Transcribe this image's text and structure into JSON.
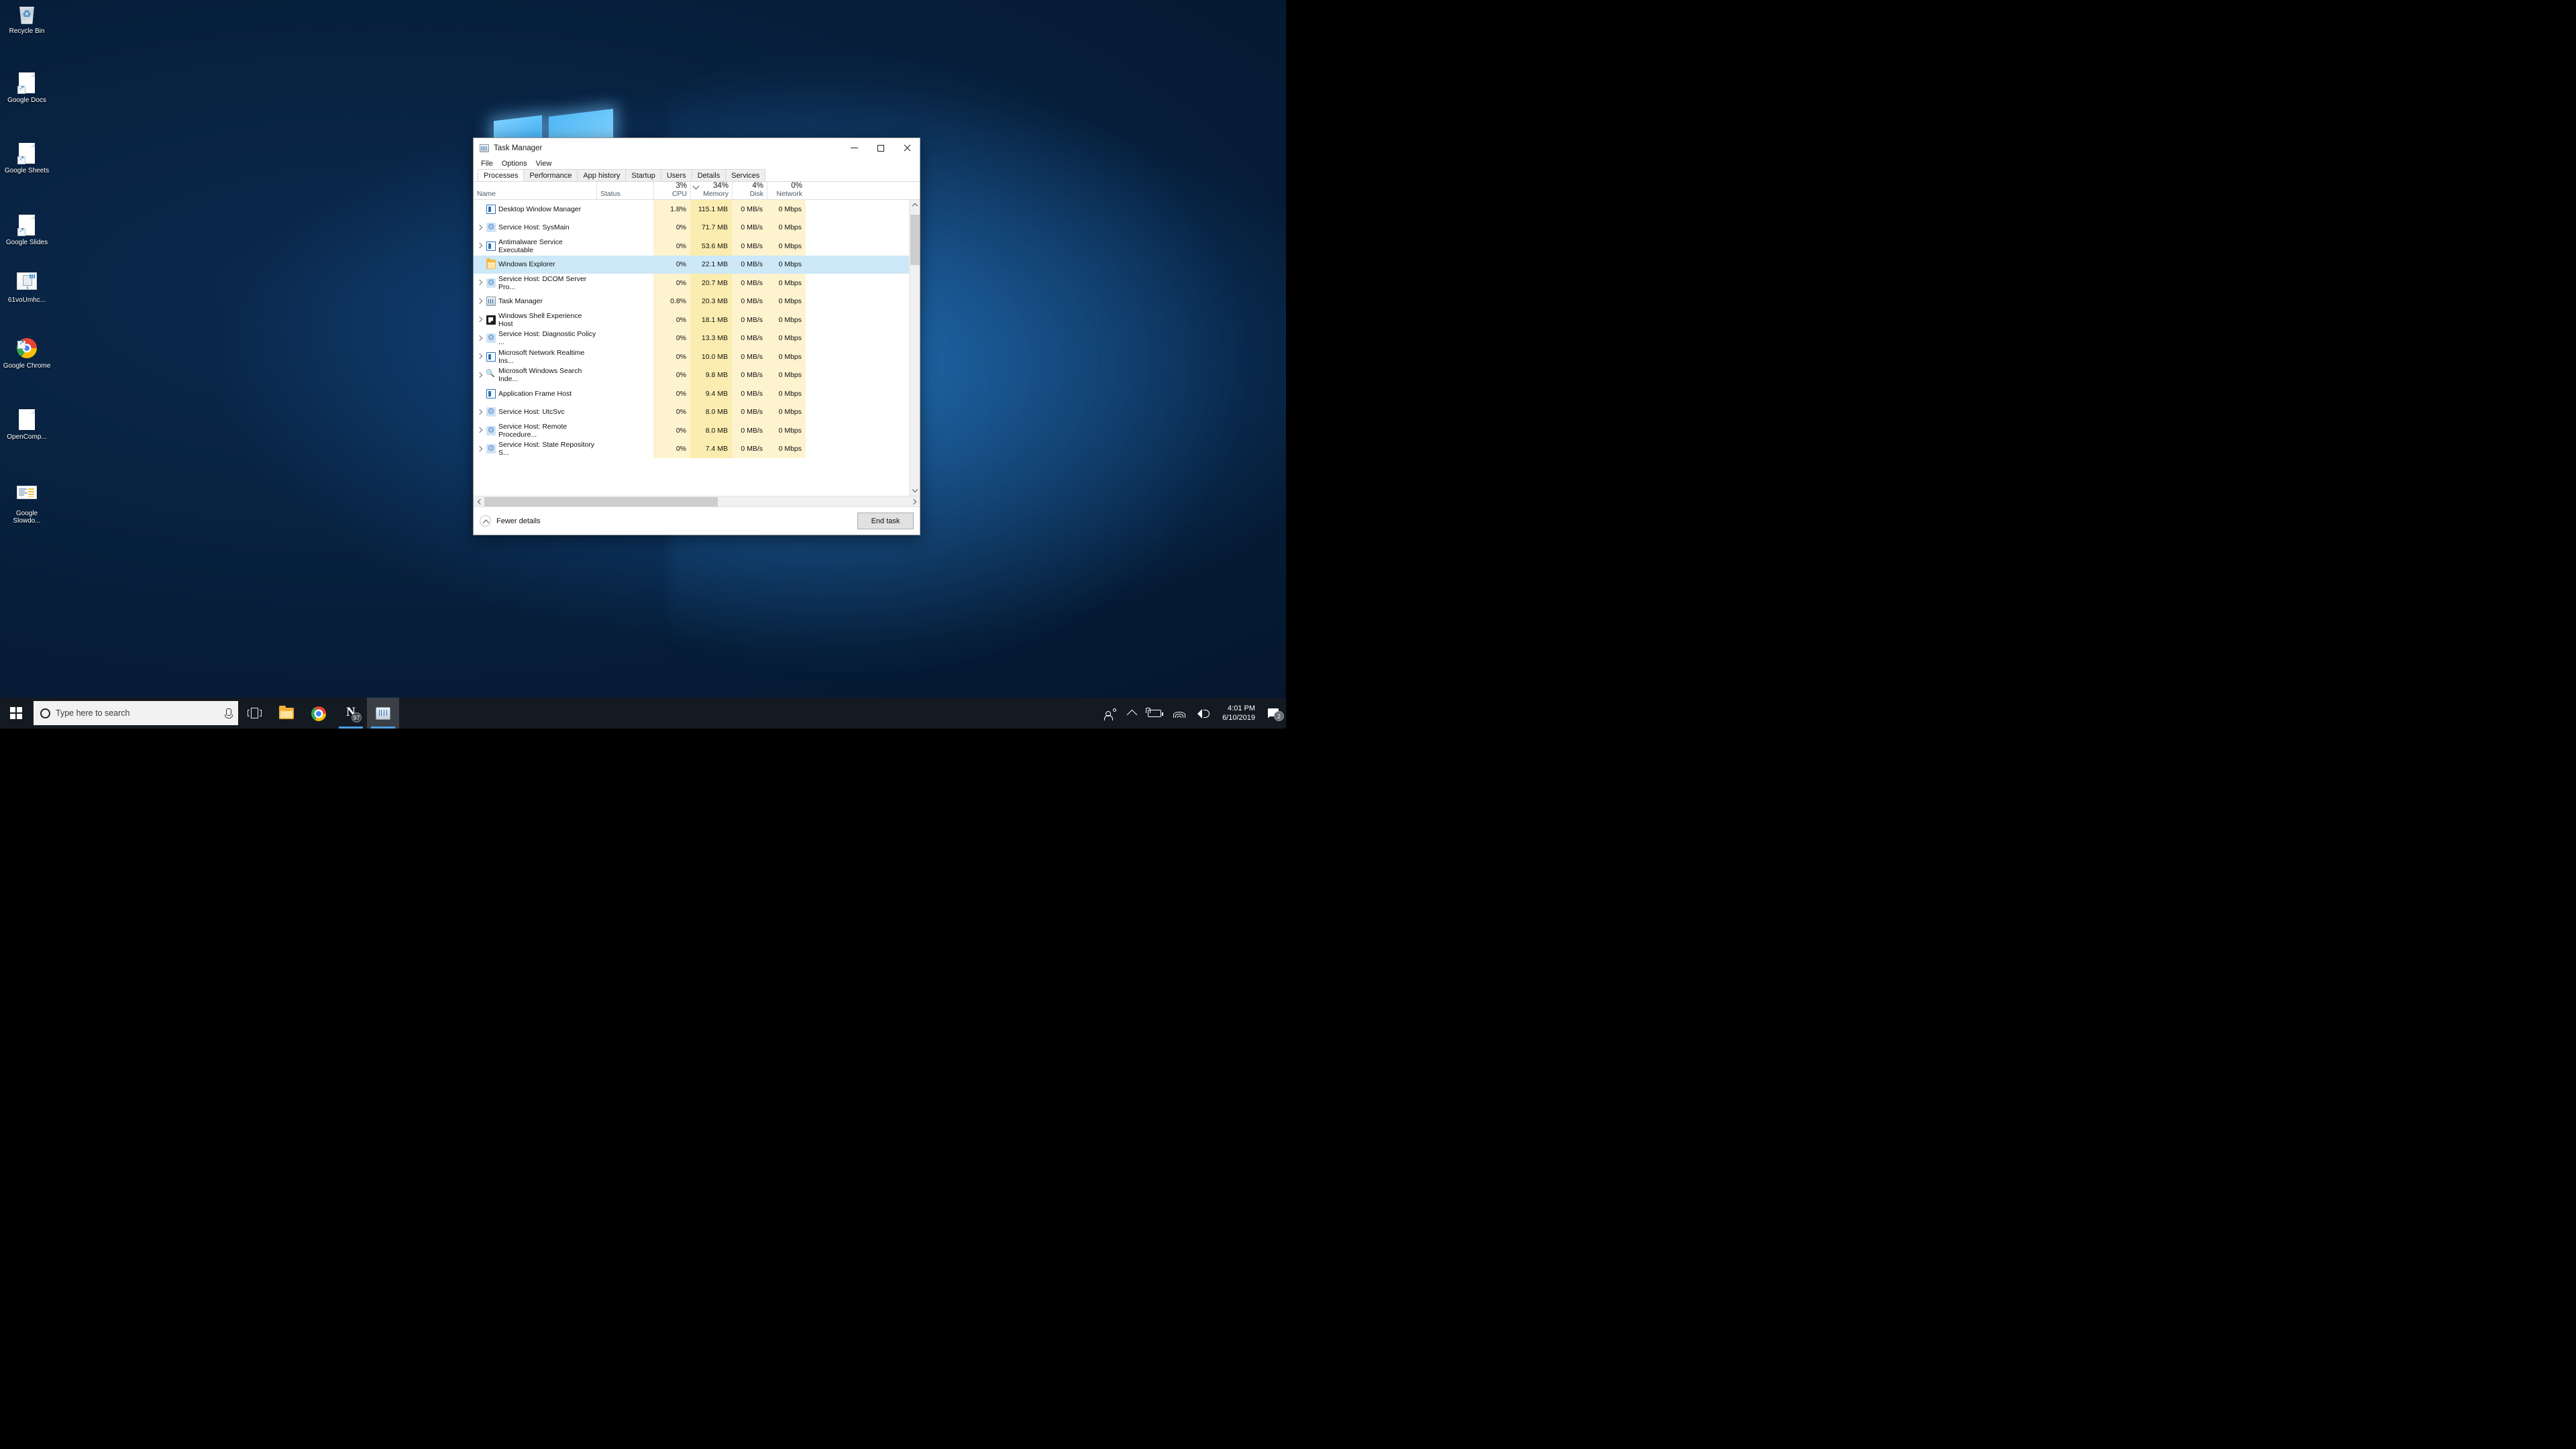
{
  "desktop": {
    "icons": [
      {
        "label": "Recycle Bin",
        "icon": "recycle-bin-icon"
      },
      {
        "label": "Google Docs",
        "icon": "document-shortcut-icon"
      },
      {
        "label": "Google Sheets",
        "icon": "document-shortcut-icon"
      },
      {
        "label": "Google Slides",
        "icon": "document-shortcut-icon"
      },
      {
        "label": "61voUmhc...",
        "icon": "image-thumbnail-icon"
      },
      {
        "label": "Google Chrome",
        "icon": "chrome-icon"
      },
      {
        "label": "OpenComp...",
        "icon": "document-icon"
      },
      {
        "label": "Google Slowdo...",
        "icon": "spreadsheet-thumbnail-icon"
      }
    ]
  },
  "taskbar": {
    "start_label": "Start",
    "search": {
      "placeholder": "Type here to search",
      "value": ""
    },
    "buttons": [
      {
        "name": "task-view",
        "label": "Task View"
      },
      {
        "name": "file-explorer",
        "label": "File Explorer"
      },
      {
        "name": "google-chrome",
        "label": "Google Chrome"
      },
      {
        "name": "onenote",
        "label": "OneNote",
        "badge": "97"
      },
      {
        "name": "task-manager",
        "label": "Task Manager",
        "active": true
      }
    ],
    "tray": {
      "people_label": "People",
      "show_hidden_label": "Show hidden icons",
      "battery_label": "Battery",
      "network_label": "Network",
      "volume_label": "Volume",
      "time": "4:01 PM",
      "date": "6/10/2019",
      "notifications_count": "2"
    }
  },
  "task_manager": {
    "title": "Task Manager",
    "window_controls": {
      "minimize": "Minimize",
      "maximize": "Maximize",
      "close": "Close"
    },
    "menu": [
      "File",
      "Options",
      "View"
    ],
    "tabs": [
      {
        "label": "Processes",
        "active": true
      },
      {
        "label": "Performance",
        "active": false
      },
      {
        "label": "App history",
        "active": false
      },
      {
        "label": "Startup",
        "active": false
      },
      {
        "label": "Users",
        "active": false
      },
      {
        "label": "Details",
        "active": false
      },
      {
        "label": "Services",
        "active": false
      }
    ],
    "columns": [
      {
        "key": "name",
        "label": "Name",
        "total": ""
      },
      {
        "key": "status",
        "label": "Status",
        "total": ""
      },
      {
        "key": "cpu",
        "label": "CPU",
        "total": "3%"
      },
      {
        "key": "memory",
        "label": "Memory",
        "total": "34%",
        "sorted": true
      },
      {
        "key": "disk",
        "label": "Disk",
        "total": "4%"
      },
      {
        "key": "network",
        "label": "Network",
        "total": "0%"
      }
    ],
    "sort_column": "memory",
    "sort_direction": "descending",
    "rows": [
      {
        "name": "Desktop Window Manager",
        "icon": "window-icon",
        "expandable": false,
        "status": "",
        "cpu": "1.8%",
        "memory": "115.1 MB",
        "disk": "0 MB/s",
        "network": "0 Mbps",
        "selected": false
      },
      {
        "name": "Service Host: SysMain",
        "icon": "gear-icon",
        "expandable": true,
        "status": "",
        "cpu": "0%",
        "memory": "71.7 MB",
        "disk": "0 MB/s",
        "network": "0 Mbps",
        "selected": false
      },
      {
        "name": "Antimalware Service Executable",
        "icon": "window-icon",
        "expandable": true,
        "status": "",
        "cpu": "0%",
        "memory": "53.6 MB",
        "disk": "0 MB/s",
        "network": "0 Mbps",
        "selected": false
      },
      {
        "name": "Windows Explorer",
        "icon": "folder-icon",
        "expandable": false,
        "status": "",
        "cpu": "0%",
        "memory": "22.1 MB",
        "disk": "0 MB/s",
        "network": "0 Mbps",
        "selected": true
      },
      {
        "name": "Service Host: DCOM Server Pro...",
        "icon": "gear-icon",
        "expandable": true,
        "status": "",
        "cpu": "0%",
        "memory": "20.7 MB",
        "disk": "0 MB/s",
        "network": "0 Mbps",
        "selected": false
      },
      {
        "name": "Task Manager",
        "icon": "taskmgr-icon",
        "expandable": true,
        "status": "",
        "cpu": "0.8%",
        "memory": "20.3 MB",
        "disk": "0 MB/s",
        "network": "0 Mbps",
        "selected": false
      },
      {
        "name": "Windows Shell Experience Host",
        "icon": "flag-icon",
        "expandable": true,
        "status": "",
        "cpu": "0%",
        "memory": "18.1 MB",
        "disk": "0 MB/s",
        "network": "0 Mbps",
        "selected": false
      },
      {
        "name": "Service Host: Diagnostic Policy ...",
        "icon": "gear-icon",
        "expandable": true,
        "status": "",
        "cpu": "0%",
        "memory": "13.3 MB",
        "disk": "0 MB/s",
        "network": "0 Mbps",
        "selected": false
      },
      {
        "name": "Microsoft Network Realtime Ins...",
        "icon": "window-icon",
        "expandable": true,
        "status": "",
        "cpu": "0%",
        "memory": "10.0 MB",
        "disk": "0 MB/s",
        "network": "0 Mbps",
        "selected": false
      },
      {
        "name": "Microsoft Windows Search Inde...",
        "icon": "search-icon",
        "expandable": true,
        "status": "",
        "cpu": "0%",
        "memory": "9.8 MB",
        "disk": "0 MB/s",
        "network": "0 Mbps",
        "selected": false
      },
      {
        "name": "Application Frame Host",
        "icon": "window-icon",
        "expandable": false,
        "status": "",
        "cpu": "0%",
        "memory": "9.4 MB",
        "disk": "0 MB/s",
        "network": "0 Mbps",
        "selected": false
      },
      {
        "name": "Service Host: UtcSvc",
        "icon": "gear-icon",
        "expandable": true,
        "status": "",
        "cpu": "0%",
        "memory": "8.0 MB",
        "disk": "0 MB/s",
        "network": "0 Mbps",
        "selected": false
      },
      {
        "name": "Service Host: Remote Procedure...",
        "icon": "gear-icon",
        "expandable": true,
        "status": "",
        "cpu": "0%",
        "memory": "8.0 MB",
        "disk": "0 MB/s",
        "network": "0 Mbps",
        "selected": false
      },
      {
        "name": "Service Host: State Repository S...",
        "icon": "gear-icon",
        "expandable": true,
        "status": "",
        "cpu": "0%",
        "memory": "7.4 MB",
        "disk": "0 MB/s",
        "network": "0 Mbps",
        "selected": false
      }
    ],
    "footer": {
      "fewer_details_label": "Fewer details",
      "end_task_label": "End task"
    },
    "heat_colors": {
      "cpu": "#fdf3cf",
      "memory": "#fbedb0",
      "disk": "#fdf3cf",
      "network": "#fdf3cf",
      "selection": "#cde8f7"
    }
  }
}
